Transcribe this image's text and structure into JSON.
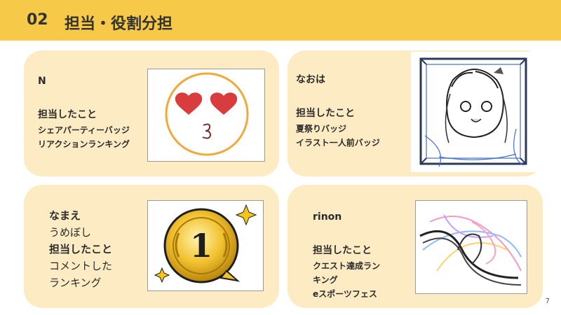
{
  "header": {
    "number": "02",
    "title": "担当・役割分担"
  },
  "cards": [
    {
      "name": "N",
      "section_label": "担当したこと",
      "items": [
        "シェアパーティーバッジ",
        "リアクションランキング"
      ],
      "image_icon": "kiss-face-emoji"
    },
    {
      "name": "なおは",
      "section_label": "担当したこと",
      "items": [
        "夏祭りバッジ",
        "イラスト一人前バッジ"
      ],
      "image_icon": "anime-character-sketch"
    },
    {
      "name_label": "なまえ",
      "name": "うめぼし",
      "section_label": "担当したこと",
      "items": [
        "コメントした",
        "ランキング"
      ],
      "image_icon": "gold-medal-number-one",
      "medal_text": "1"
    },
    {
      "name": "rinon",
      "section_label": "担当したこと",
      "items": [
        "クエスト達成ラン",
        "キング",
        "eスポーツフェス"
      ],
      "image_icon": "colorful-scribble-sketch"
    }
  ],
  "page_number": "7",
  "colors": {
    "header": "#f7c948",
    "card": "#fdebc4"
  }
}
